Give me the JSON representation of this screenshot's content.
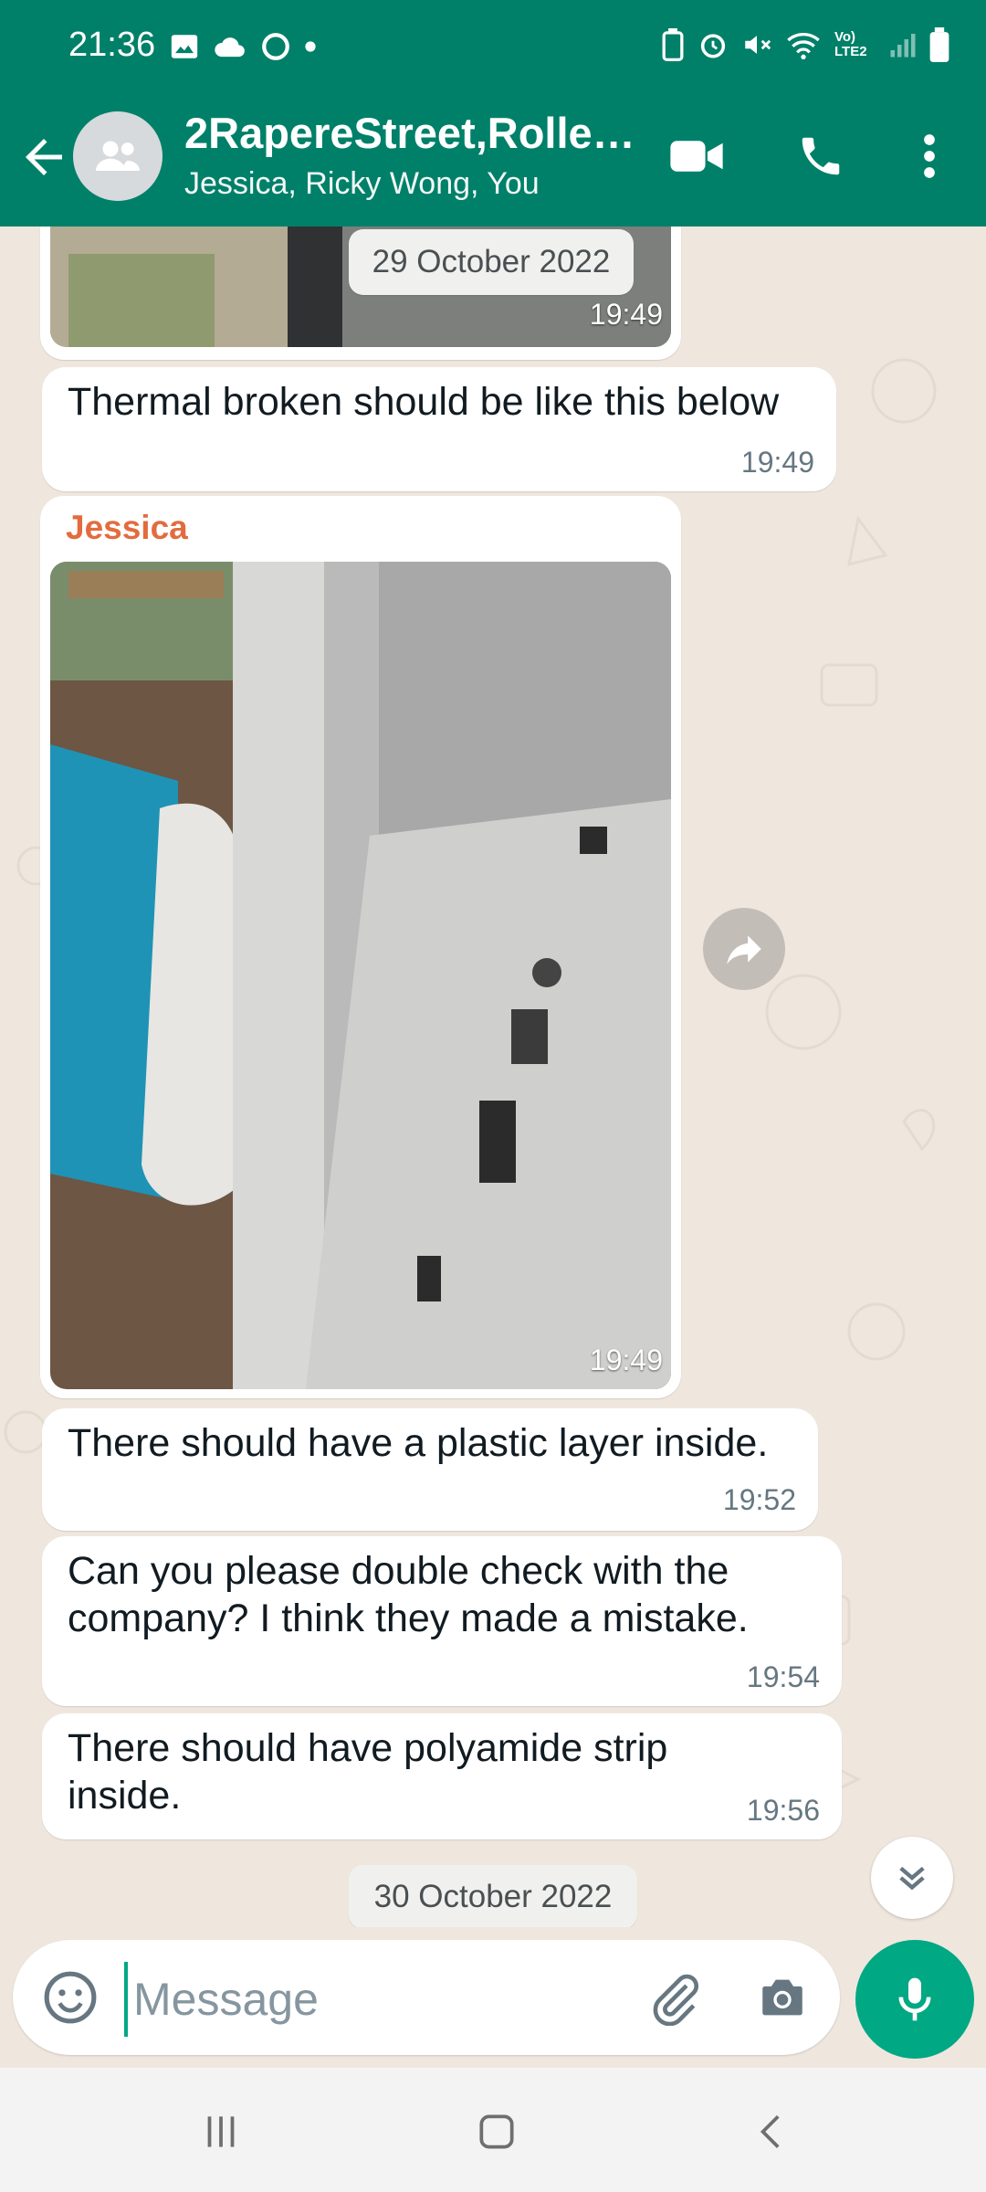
{
  "status_bar": {
    "time": "21:36",
    "network": "Vo) LTE2"
  },
  "header": {
    "title": "2RapereStreet,Rolle…",
    "subtitle": "Jessica, Ricky Wong, You"
  },
  "chat": {
    "top_image": {
      "date_overlay": "29 October 2022",
      "time": "19:49"
    },
    "messages": [
      {
        "text": "Thermal broken should be like this below",
        "time": "19:49"
      },
      {
        "sender": "Jessica",
        "type": "image",
        "time": "19:49"
      },
      {
        "text": "There should have a plastic layer inside.",
        "time": "19:52"
      },
      {
        "text": "Can you please double check with the company? I think they made a mistake.",
        "time": "19:54"
      },
      {
        "text": "There should have polyamide strip inside.",
        "time": "19:56"
      }
    ],
    "date_separator": "30 October 2022"
  },
  "composer": {
    "placeholder": "Message"
  },
  "colors": {
    "brand": "#008069",
    "accent": "#00a884",
    "sender": "#e26c3e",
    "chat_bg": "#efe7de"
  }
}
